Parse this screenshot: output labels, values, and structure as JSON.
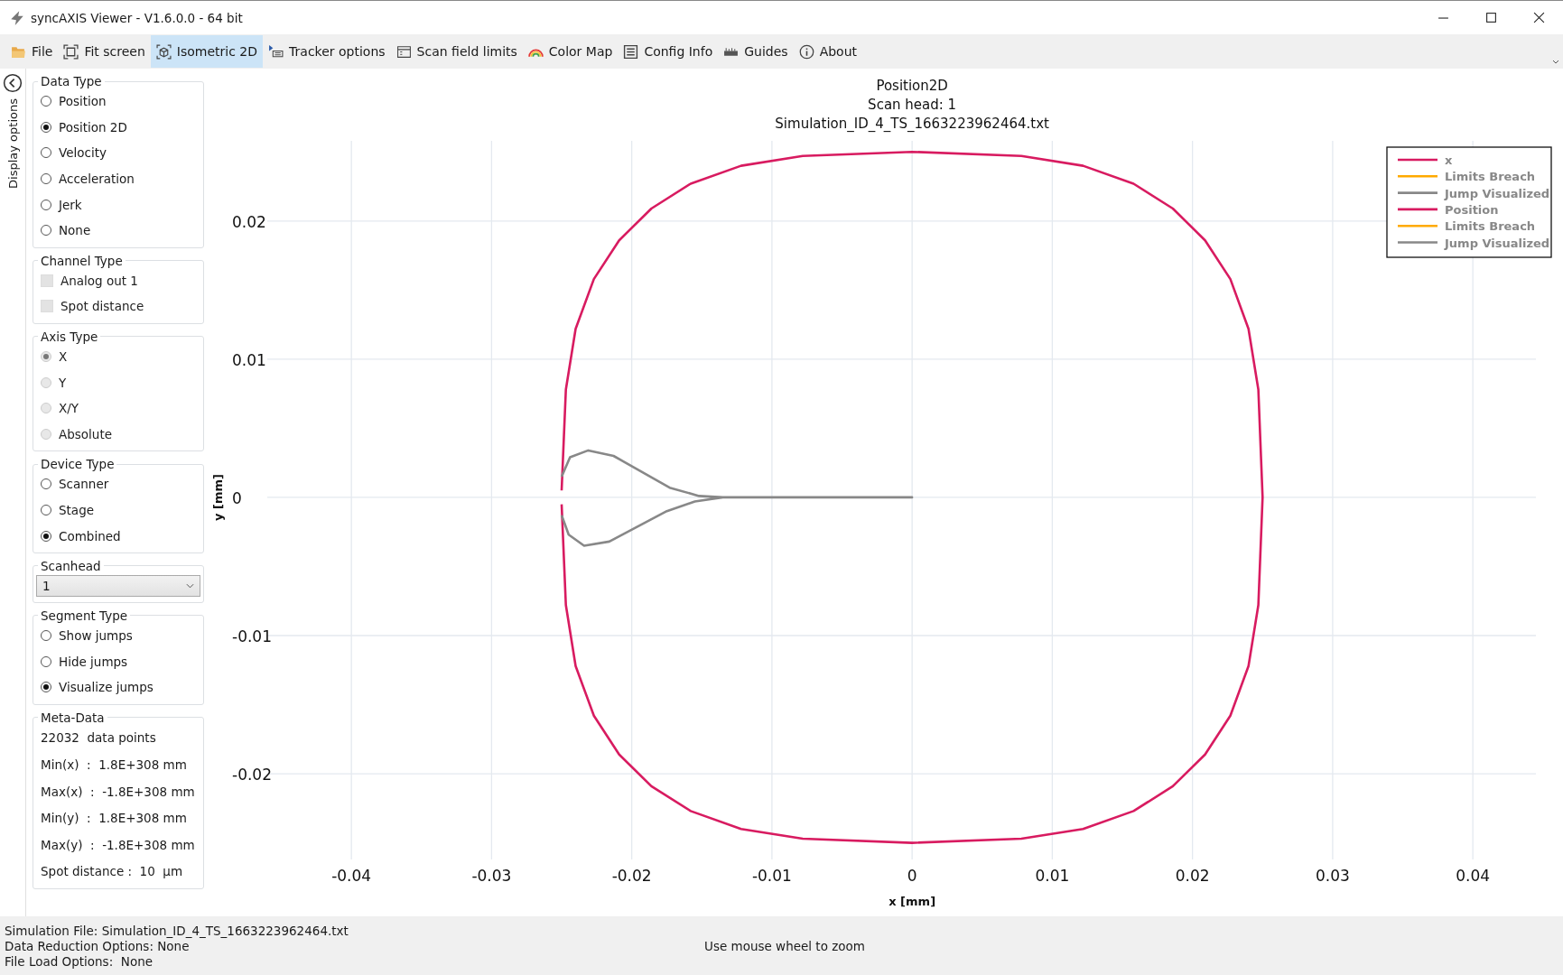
{
  "window": {
    "title": "syncAXIS Viewer - V1.6.0.0 - 64 bit"
  },
  "toolbar": [
    {
      "label": "File",
      "kind": "folder",
      "selected": false
    },
    {
      "label": "Fit screen",
      "kind": "fit",
      "selected": false
    },
    {
      "label": "Isometric 2D",
      "kind": "iso",
      "selected": true
    },
    {
      "label": "Tracker options",
      "kind": "tracker",
      "selected": false
    },
    {
      "label": "Scan field limits",
      "kind": "window",
      "selected": false
    },
    {
      "label": "Color Map",
      "kind": "rainbow",
      "selected": false
    },
    {
      "label": "Config Info",
      "kind": "list",
      "selected": false
    },
    {
      "label": "Guides",
      "kind": "ruler",
      "selected": false
    },
    {
      "label": "About",
      "kind": "info",
      "selected": false
    }
  ],
  "sidebar": {
    "tab": "Display options",
    "groups": [
      {
        "kind": "radio",
        "title": "Data Type",
        "disabled": false,
        "items": [
          {
            "label": "Position",
            "selected": false
          },
          {
            "label": "Position 2D",
            "selected": true
          },
          {
            "label": "Velocity",
            "selected": false
          },
          {
            "label": "Acceleration",
            "selected": false
          },
          {
            "label": "Jerk",
            "selected": false
          },
          {
            "label": "None",
            "selected": false
          }
        ]
      },
      {
        "kind": "check",
        "title": "Channel Type",
        "disabled": true,
        "items": [
          {
            "label": "Analog out 1",
            "checked": false
          },
          {
            "label": "Spot distance",
            "checked": false
          }
        ]
      },
      {
        "kind": "radio",
        "title": "Axis Type",
        "disabled": true,
        "items": [
          {
            "label": "X",
            "selected": true
          },
          {
            "label": "Y",
            "selected": false
          },
          {
            "label": "X/Y",
            "selected": false
          },
          {
            "label": "Absolute",
            "selected": false
          }
        ]
      },
      {
        "kind": "radio",
        "title": "Device Type",
        "disabled": false,
        "items": [
          {
            "label": "Scanner",
            "selected": false
          },
          {
            "label": "Stage",
            "selected": false
          },
          {
            "label": "Combined",
            "selected": true
          }
        ]
      },
      {
        "kind": "dropdown",
        "title": "Scanhead",
        "value": "1"
      },
      {
        "kind": "radio",
        "title": "Segment Type",
        "disabled": false,
        "items": [
          {
            "label": "Show jumps",
            "selected": false
          },
          {
            "label": "Hide jumps",
            "selected": false
          },
          {
            "label": "Visualize jumps",
            "selected": true
          }
        ]
      },
      {
        "kind": "info",
        "title": "Meta-Data",
        "lines": [
          "22032  data points",
          "Min(x)  :  1.8E+308 mm",
          "Max(x)  :  -1.8E+308 mm",
          "Min(y)  :  1.8E+308 mm",
          "Max(y)  :  -1.8E+308 mm",
          "Spot distance :  10  µm"
        ]
      }
    ]
  },
  "plot": {
    "chart_data": {
      "type": "line",
      "title": [
        "Position2D",
        "Scan head: 1",
        "Simulation_ID_4_TS_1663223962464.txt"
      ],
      "xlabel": "x [mm]",
      "ylabel": "y [mm]",
      "xlim": [
        -0.046,
        0.0445
      ],
      "ylim": [
        -0.0262,
        0.0258
      ],
      "xticks": [
        -0.04,
        -0.03,
        -0.02,
        -0.01,
        0,
        0.01,
        0.02,
        0.03,
        0.04
      ],
      "yticks": [
        -0.02,
        -0.01,
        0,
        0.01,
        0.02
      ],
      "grid": true,
      "legend": true,
      "series": [
        {
          "name": "x",
          "color": "#d81b60",
          "x": [
            -0.025,
            -0.0247,
            -0.024,
            -0.0227,
            -0.0209,
            -0.0186,
            -0.0158,
            -0.0122,
            -0.0078,
            0,
            0.0078,
            0.0122,
            0.0158,
            0.0186,
            0.0209,
            0.0227,
            0.024,
            0.0247,
            0.025,
            0.0247,
            0.024,
            0.0227,
            0.0209,
            0.0186,
            0.0158,
            0.0122,
            0.0078,
            0,
            -0.0078,
            -0.0122,
            -0.0158,
            -0.0186,
            -0.0209,
            -0.0227,
            -0.024,
            -0.0247,
            -0.025
          ],
          "values": [
            0.0005,
            0.0078,
            0.0122,
            0.0158,
            0.0186,
            0.0209,
            0.0227,
            0.024,
            0.0247,
            0.025,
            0.0247,
            0.024,
            0.0227,
            0.0209,
            0.0186,
            0.0158,
            0.0122,
            0.0078,
            0,
            -0.0078,
            -0.0122,
            -0.0158,
            -0.0186,
            -0.0209,
            -0.0227,
            -0.024,
            -0.0247,
            -0.025,
            -0.0247,
            -0.024,
            -0.0227,
            -0.0209,
            -0.0186,
            -0.0158,
            -0.0122,
            -0.0078,
            -0.0005
          ]
        },
        {
          "name": "Limits Breach",
          "color": "#ffaa00"
        },
        {
          "name": "Jump Visualized",
          "color": "#888888",
          "x": [
            -0.025,
            -0.0244,
            -0.0231,
            -0.0213,
            -0.0173,
            -0.0152,
            -0.0135,
            0,
            -0.0135,
            -0.0155,
            -0.0175,
            -0.0216,
            -0.0234,
            -0.0245,
            -0.025
          ],
          "values": [
            0.0015,
            0.0029,
            0.0034,
            0.003,
            0.0007,
            0.0001,
            0,
            0,
            0,
            -0.0003,
            -0.001,
            -0.0032,
            -0.0035,
            -0.0027,
            -0.0013
          ]
        },
        {
          "name": "Position",
          "color": "#d81b60"
        },
        {
          "name": "Limits Breach",
          "color": "#ffaa00"
        },
        {
          "name": "Jump Visualized",
          "color": "#888888"
        }
      ]
    }
  },
  "status_bar": {
    "lines": [
      "Simulation File: Simulation_ID_4_TS_1663223962464.txt",
      "Data Reduction Options: None",
      "File Load Options:  None"
    ],
    "hint": "Use mouse wheel to zoom"
  }
}
